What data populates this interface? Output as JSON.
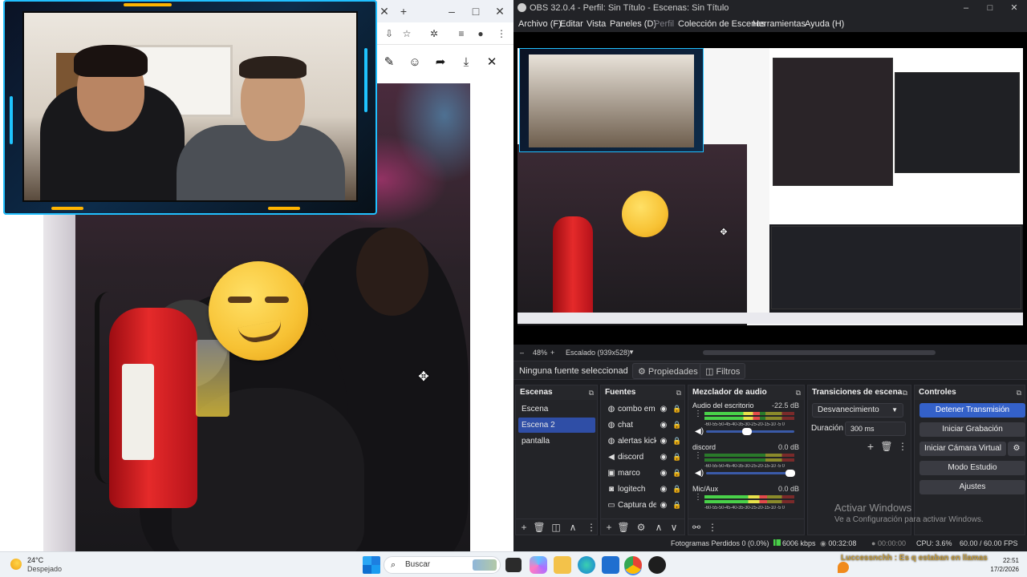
{
  "browser": {
    "toolbar_icons": [
      "close-tab-icon",
      "new-tab-icon",
      "minimize-icon",
      "maximize-icon",
      "close-window-icon"
    ],
    "viewer_icons": [
      "pin-icon",
      "emoji-icon",
      "share-icon",
      "download-icon",
      "close-icon"
    ]
  },
  "obs": {
    "title": "OBS 32.0.4 - Perfil: Sin Título - Escenas: Sin Título",
    "menu": [
      {
        "label": "Archivo (F)",
        "enabled": true
      },
      {
        "label": "Editar",
        "enabled": true
      },
      {
        "label": "Vista",
        "enabled": true
      },
      {
        "label": "Paneles (D)",
        "enabled": true
      },
      {
        "label": "Perfil",
        "enabled": false
      },
      {
        "label": "Colección de Escenas",
        "enabled": true
      },
      {
        "label": "Herramientas",
        "enabled": true
      },
      {
        "label": "Ayuda (H)",
        "enabled": true
      }
    ],
    "preview": {
      "zoom": "48%",
      "scale": "Escalado (939x528)"
    },
    "source_toolbar": {
      "label": "Ninguna fuente seleccionad",
      "properties": "Propiedades",
      "filters": "Filtros"
    },
    "docks": {
      "scenes": {
        "title": "Escenas",
        "items": [
          {
            "label": "Escena",
            "selected": false
          },
          {
            "label": "Escena 2",
            "selected": true
          },
          {
            "label": "pantalla",
            "selected": false
          }
        ]
      },
      "sources": {
        "title": "Fuentes",
        "items": [
          {
            "label": "combo em",
            "icon": "globe-icon"
          },
          {
            "label": "chat",
            "icon": "globe-icon"
          },
          {
            "label": "alertas kick",
            "icon": "globe-icon"
          },
          {
            "label": "discord",
            "icon": "speaker-icon"
          },
          {
            "label": "marco",
            "icon": "image-icon"
          },
          {
            "label": "logitech",
            "icon": "camera-icon"
          },
          {
            "label": "Captura de",
            "icon": "monitor-icon"
          }
        ]
      },
      "mixer": {
        "title": "Mezclador de audio",
        "ticks": "-60-55-50-45-40-35-30-25-20-15-10 -5 0",
        "channels": [
          {
            "name": "Audio del escritorio",
            "db": "-22.5 dB",
            "level": 0.62,
            "volume": 0.46
          },
          {
            "name": "discord",
            "db": "0.0 dB",
            "level": 0.0,
            "volume": 0.95
          },
          {
            "name": "Mic/Aux",
            "db": "0.0 dB",
            "level": 0.7,
            "volume": 0.95
          }
        ]
      },
      "transitions": {
        "title": "Transiciones de escena",
        "selected": "Desvanecimiento",
        "duration_label": "Duración",
        "duration_value": "300 ms"
      },
      "controls": {
        "title": "Controles",
        "buttons": [
          {
            "label": "Detener Transmisión",
            "primary": true
          },
          {
            "label": "Iniciar Grabación",
            "primary": false
          },
          {
            "label": "Iniciar Cámara Virtual",
            "primary": false
          },
          {
            "label": "Modo Estudio",
            "primary": false
          },
          {
            "label": "Ajustes",
            "primary": false
          }
        ]
      }
    },
    "status": {
      "dropped": "Fotogramas Perdidos 0 (0.0%)",
      "bitrate": "6006 kbps",
      "stream_time": "00:32:08",
      "record_time": "00:00:00",
      "cpu": "CPU: 3.6%",
      "fps": "60.00 / 60.00 FPS"
    }
  },
  "activate_windows": {
    "line1": "Activar Windows",
    "line2": "Ve a Configuración para activar Windows."
  },
  "taskbar": {
    "weather_temp": "24°C",
    "weather_cond": "Despejado",
    "search_placeholder": "Buscar",
    "tray_overlay": "Luccessnchh : Es q estaban en llamas",
    "time": "22:51",
    "date": "17/2/2026"
  }
}
